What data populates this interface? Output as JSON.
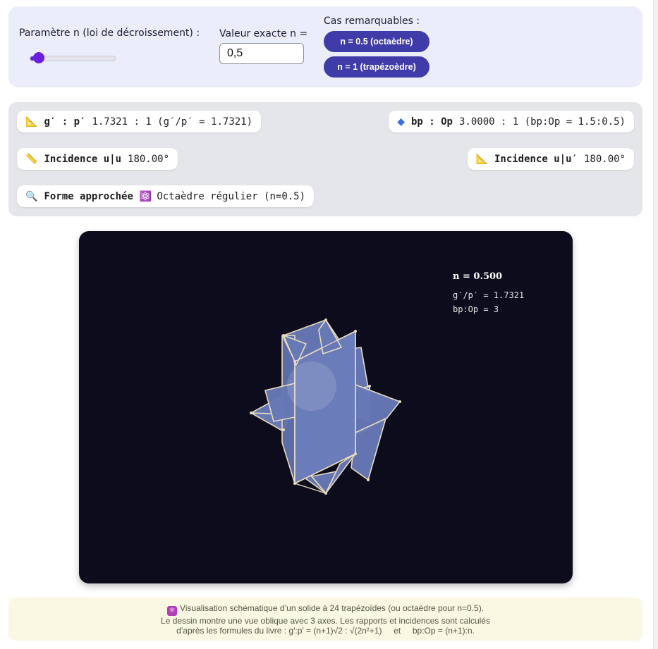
{
  "controls": {
    "param_label": "Paramètre n (loi de décroissement) :",
    "slider_fraction": 0.05,
    "exact_label": "Valeur exacte n =",
    "exact_value": "0,5",
    "cases_label": "Cas remarquables :",
    "case_buttons": [
      "n = 0.5 (octaèdre)",
      "n = 1 (trapézoèdre)"
    ]
  },
  "info": {
    "gp": {
      "icon": "triangle-ruler-icon",
      "label": "g′ : p′",
      "value": "1.7321 : 1 (g′/p′ = 1.7321)"
    },
    "bp": {
      "icon": "blue-diamond-icon",
      "label": "bp : Op",
      "value": "3.0000 : 1 (bp:Op = 1.5:0.5)"
    },
    "inc_uu": {
      "icon": "straight-ruler-icon",
      "label": "Incidence u|u",
      "value": "180.00°"
    },
    "inc_uup": {
      "icon": "triangle-ruler-icon",
      "label": "Incidence u|u′",
      "value": "180.00°"
    },
    "forme": {
      "icon": "magnifier-icon",
      "label": "Forme approchée",
      "value": "Octaèdre régulier (n=0.5)",
      "badge_icon": "atom-icon"
    }
  },
  "canvas": {
    "overlay_title": "n = 0.500",
    "overlay_lines": [
      "g′/p′ = 1.7321",
      "bp:Op = 3"
    ],
    "colors": {
      "background": "#0d0c1d",
      "face": "#6678b5",
      "edge": "#e8dcc0"
    }
  },
  "footer": {
    "line1": "Visualisation schématique d’un solide à 24 trapézoïdes (ou octaèdre pour n=0.5).",
    "line2": "Le dessin montre une vue oblique avec 3 axes. Les rapports et incidences sont calculés",
    "line3": "d’après les formules du livre : g′:p′ = (n+1)√2 : √(2n²+1)     et     bp:Op = (n+1):n."
  },
  "colors": {
    "accent": "#6a1fe0",
    "button": "#3f3ba8"
  }
}
